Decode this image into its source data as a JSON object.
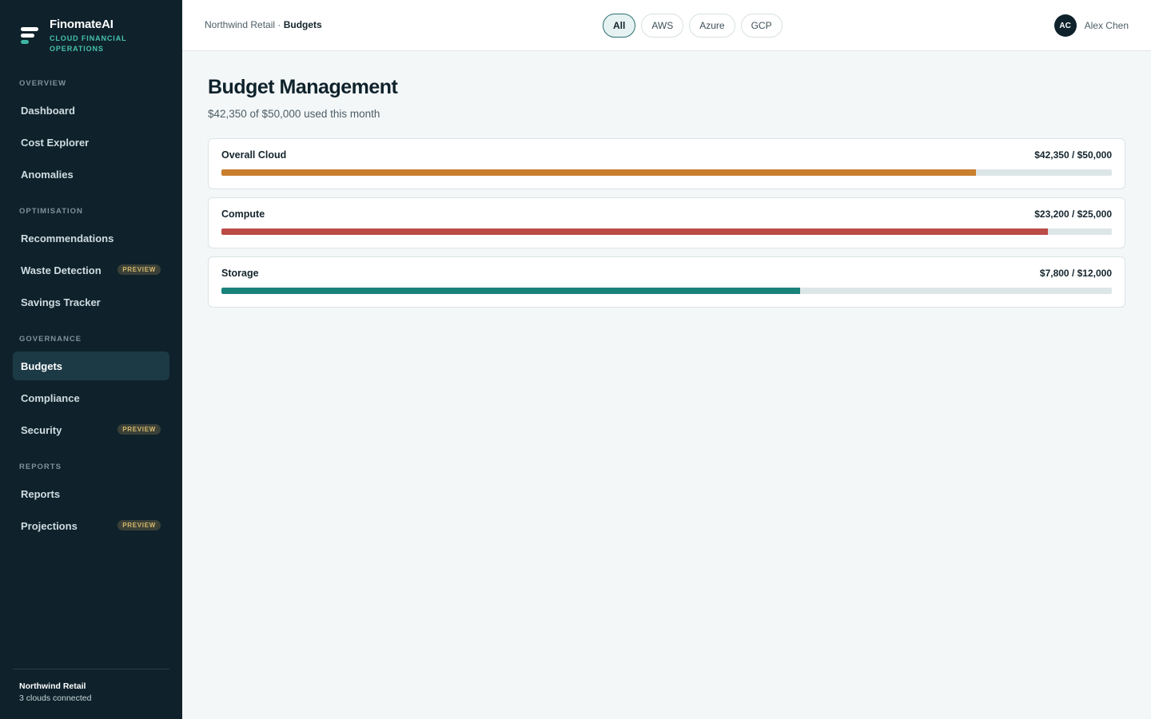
{
  "brand": {
    "name": "FinomateAI",
    "subtitle": "CLOUD FINANCIAL OPERATIONS"
  },
  "sidebar": {
    "sections": [
      {
        "label": "OVERVIEW"
      },
      {
        "label": "OPTIMISATION"
      },
      {
        "label": "GOVERNANCE"
      },
      {
        "label": "REPORTS"
      }
    ],
    "items": [
      {
        "label": "Dashboard"
      },
      {
        "label": "Cost Explorer"
      },
      {
        "label": "Anomalies"
      },
      {
        "label": "Recommendations"
      },
      {
        "label": "Waste Detection",
        "badge": "PREVIEW"
      },
      {
        "label": "Savings Tracker"
      },
      {
        "label": "Budgets",
        "active": true
      },
      {
        "label": "Compliance"
      },
      {
        "label": "Security",
        "badge": "PREVIEW"
      },
      {
        "label": "Reports"
      },
      {
        "label": "Projections",
        "badge": "PREVIEW"
      }
    ],
    "footer": {
      "tenant": "Northwind Retail",
      "status": "3 clouds connected"
    }
  },
  "header": {
    "breadcrumb": {
      "parent": "Northwind Retail",
      "separator": " · ",
      "current": "Budgets"
    },
    "filters": [
      {
        "label": "All",
        "active": true
      },
      {
        "label": "AWS"
      },
      {
        "label": "Azure"
      },
      {
        "label": "GCP"
      }
    ],
    "user": {
      "initials": "AC",
      "name": "Alex Chen"
    }
  },
  "main": {
    "title": "Budget Management",
    "subtitle": "$42,350 of $50,000 used this month",
    "budgets": [
      {
        "name": "Overall Cloud",
        "amount": "$42,350 / $50,000",
        "spent": 42350,
        "limit": 50000,
        "color": "#c97f2e"
      },
      {
        "name": "Compute",
        "amount": "$23,200 / $25,000",
        "spent": 23200,
        "limit": 25000,
        "color": "#bb4b47"
      },
      {
        "name": "Storage",
        "amount": "$7,800 / $12,000",
        "spent": 7800,
        "limit": 12000,
        "color": "#19827a"
      }
    ]
  },
  "colors": {
    "sidebar_bg": "#0f222b",
    "accent_teal": "#46c1ad",
    "preview_badge": "#d5b86a",
    "active_chip_border": "#2b6e70"
  }
}
